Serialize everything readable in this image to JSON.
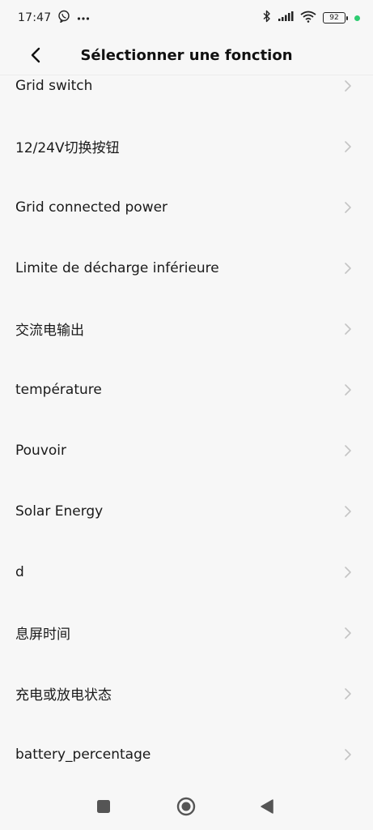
{
  "status_bar": {
    "time": "17:47",
    "battery_level": "92",
    "icons": [
      "viber-icon",
      "more-dots-icon",
      "bluetooth-icon",
      "signal-icon",
      "wifi-icon",
      "battery-icon"
    ]
  },
  "header": {
    "title": "Sélectionner une fonction"
  },
  "functions": [
    "Grid switch",
    "12/24V切换按钮",
    "Grid connected power",
    "Limite de décharge inférieure",
    "交流电输出",
    "température",
    "Pouvoir",
    "Solar Energy",
    "d",
    "息屏时间",
    "充电或放电状态",
    "battery_percentage"
  ],
  "colors": {
    "background": "#f7f7f7",
    "text": "#1a1a1a",
    "chevron": "#c4c4c4",
    "status_dot": "#2ecc71"
  }
}
